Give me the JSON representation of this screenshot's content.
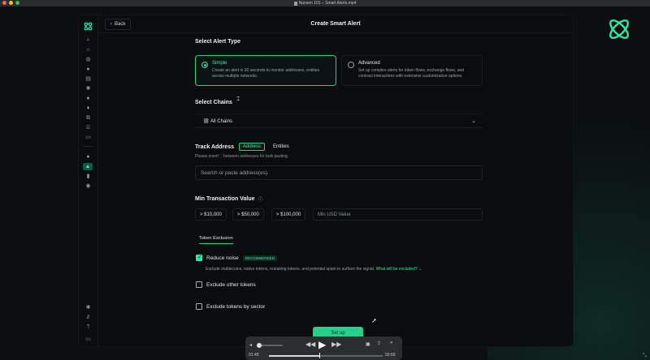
{
  "window": {
    "title": "Nansen 101 – Smart Alerts.mp4",
    "colors": {
      "accent": "#23d18b",
      "accent_text": "#39e7a9",
      "bg": "#0a0d0e"
    }
  },
  "topbar": {
    "back_label": "Back",
    "page_title": "Create Smart Alert"
  },
  "alert_type": {
    "heading": "Select Alert Type",
    "options": [
      {
        "title": "Simple",
        "desc_1": "Create an alert in 30 seconds to monitor addresses, entities",
        "desc_2": "across multiple networks.",
        "selected": true
      },
      {
        "title": "Advanced",
        "desc_1": "Set up complex alerts for token flows, exchange flows, and",
        "desc_2": "contract interactions with extensive customization options.",
        "selected": false
      }
    ]
  },
  "chains": {
    "heading": "Select Chains",
    "selected": "All Chains"
  },
  "track": {
    "heading": "Track Address",
    "toggle": [
      "Address",
      "Entities"
    ],
    "active": "Address",
    "hint": "Please insert ',' between addresses for bulk pasting.",
    "placeholder": "Search or paste address(es)."
  },
  "min_tx": {
    "heading": "Min Transaction Value",
    "presets": [
      "> $10,000",
      "> $50,000",
      "> $100,000"
    ],
    "placeholder": "Min USD Value"
  },
  "token_exclusion": {
    "tab": "Token Exclusion",
    "reduce_noise": {
      "label": "Reduce noise",
      "badge": "RECOMMENDED",
      "checked": true,
      "desc": "Exclude stablecoins, native tokens, restaking tokens, and potential spam to surface the signal.",
      "link": "What will be excluded?"
    },
    "exclude_other": {
      "label": "Exclude other tokens",
      "checked": false
    },
    "exclude_sector": {
      "label": "Exclude tokens by sector",
      "checked": false
    }
  },
  "setup_label": "Set up",
  "player": {
    "elapsed": "01:45",
    "remaining": "03:59",
    "progress": 0.44,
    "volume": 0.1
  }
}
